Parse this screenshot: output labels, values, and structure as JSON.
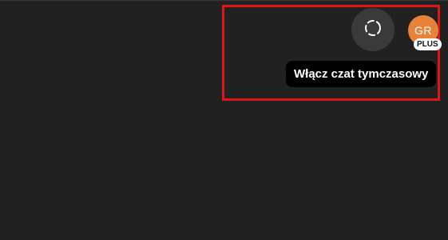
{
  "header": {
    "temp_chat_icon": "temporary-chat-dashed-circle-icon",
    "tooltip_text": "Włącz czat tymczasowy",
    "avatar_initials": "GR",
    "avatar_color": "#e8813a",
    "plan_badge": "PLUS"
  },
  "annotation": {
    "highlight_color": "#e01515"
  }
}
